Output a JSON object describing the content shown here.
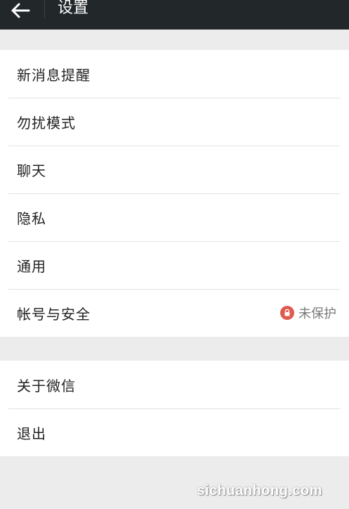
{
  "header": {
    "title": "设置",
    "back_icon": "arrow-left-icon"
  },
  "group1": {
    "items": [
      {
        "label": "新消息提醒"
      },
      {
        "label": "勿扰模式"
      },
      {
        "label": "聊天"
      },
      {
        "label": "隐私"
      },
      {
        "label": "通用"
      },
      {
        "label": "帐号与安全",
        "status": "未保护",
        "status_icon": "lock-icon",
        "status_color": "#e05a4f"
      }
    ]
  },
  "group2": {
    "items": [
      {
        "label": "关于微信"
      },
      {
        "label": "退出"
      }
    ]
  },
  "watermark": "sichuanhong.com",
  "colors": {
    "topbar": "#22282a",
    "background": "#ececec",
    "row": "#ffffff",
    "divider": "#e3e3e3"
  }
}
